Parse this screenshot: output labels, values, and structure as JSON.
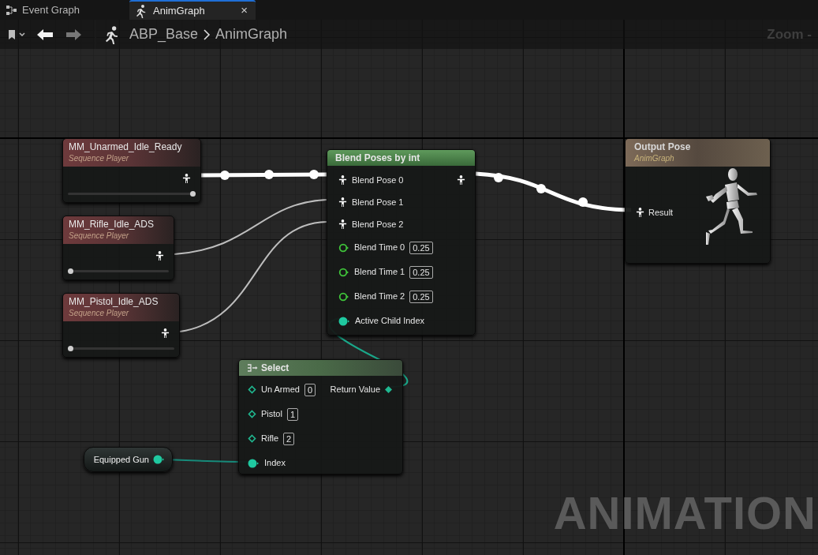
{
  "tabs": [
    {
      "label": "Event Graph",
      "selected": false
    },
    {
      "label": "AnimGraph",
      "selected": true,
      "close": "×"
    }
  ],
  "toolbar": {
    "breadcrumb": [
      "ABP_Base",
      "AnimGraph"
    ],
    "zoom": "Zoom -"
  },
  "nodes": [
    {
      "kind": "sequence_player",
      "title": "MM_Unarmed_Idle_Ready",
      "subtitle": "Sequence Player",
      "level": 1
    },
    {
      "kind": "sequence_player",
      "title": "MM_Rifle_Idle_ADS",
      "subtitle": "Sequence Player",
      "level": 0
    },
    {
      "kind": "sequence_player",
      "title": "MM_Pistol_Idle_ADS",
      "subtitle": "Sequence Player",
      "level": 0
    },
    {
      "kind": "blend",
      "title": "Blend Poses by int",
      "inputs": [
        {
          "kind": "pose",
          "label": "Blend Pose 0"
        },
        {
          "kind": "pose",
          "label": "Blend Pose 1"
        },
        {
          "kind": "pose",
          "label": "Blend Pose 2"
        },
        {
          "kind": "float",
          "label": "Blend Time 0",
          "value": "0.25"
        },
        {
          "kind": "float",
          "label": "Blend Time 1",
          "value": "0.25"
        },
        {
          "kind": "float",
          "label": "Blend Time 2",
          "value": "0.25"
        },
        {
          "kind": "int",
          "label": "Active Child Index"
        }
      ],
      "output": {
        "kind": "pose"
      }
    },
    {
      "kind": "variable",
      "title": "Equipped Gun"
    },
    {
      "kind": "select",
      "title": "Select",
      "inputs": [
        {
          "kind": "enum",
          "label": "Un Armed",
          "value": "0"
        },
        {
          "kind": "enum",
          "label": "Pistol",
          "value": "1"
        },
        {
          "kind": "enum",
          "label": "Rifle",
          "value": "2"
        },
        {
          "kind": "int",
          "label": "Index"
        }
      ],
      "output": {
        "kind": "enum",
        "label": "Return Value"
      }
    },
    {
      "kind": "output",
      "title": "Output Pose",
      "subtitle": "AnimGraph",
      "inputs": [
        {
          "kind": "pose",
          "label": "Result"
        }
      ]
    }
  ],
  "graph_label": "ANIMATION"
}
